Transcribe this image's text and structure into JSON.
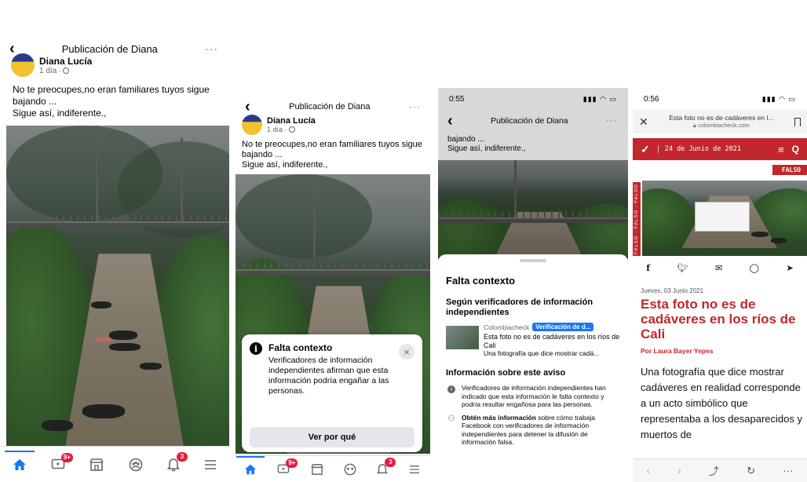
{
  "post": {
    "header_title": "Publicación de Diana",
    "author": "Diana Lucía",
    "time": "1 día ·",
    "text_line1": "No te preocupes,no eran familiares tuyos sigue bajando ...",
    "text_line2": "Sigue así, indiferente.,",
    "text_line2_p3": "bajando ...",
    "back_glyph": "‹",
    "more_glyph": "···"
  },
  "tabbar": {
    "video_badge": "9+",
    "notifications_badge": "3",
    "icons": [
      "home-icon",
      "video-icon",
      "marketplace-icon",
      "groups-icon",
      "notifications-icon",
      "menu-icon"
    ],
    "accent": "#1877f2",
    "badge_color": "#e41e3f"
  },
  "notice": {
    "title": "Falta contexto",
    "body": "Verificadores de información independientes afirman que esta información podría engañar a las personas.",
    "button": "Ver por qué"
  },
  "status": {
    "time_p3": "0:55",
    "time_p4": "0:56"
  },
  "sheet": {
    "title": "Falta contexto",
    "subtitle": "Según verificadores de información independientes",
    "source": "Colombiacheck",
    "verif_label": "Verificación de d...",
    "article_title": "Esta foto no es de cadáveres en los ríos de Cali",
    "article_desc": "Una fotografía que dice mostrar cadá...",
    "section_title": "Información sobre este aviso",
    "item1": "Verificadores de información independientes han indicado que esta información le falta contexto y podría resultar engañosa para las personas.",
    "item2_bold": "Obtén más información",
    "item2_rest": " sobre cómo trabaja Facebook con verificadores de información independientes para detener la difusión de información falsa."
  },
  "article": {
    "url_title": "Esta foto no es de cadáveres en l...",
    "url_domain": "colombiacheck.com",
    "nav_date": "24 de Junio de 2021",
    "falso_tag": "FALSO",
    "strip_text": "FALSO · FALSO · FALSO",
    "pub_date": "Jueves, 03 Junio 2021",
    "headline": "Esta foto no es de cadáveres en los ríos de Cali",
    "byline": "Por Laura Bayer Yepes",
    "body": "Una fotografía que dice mostrar cadáveres en realidad corresponde a un acto simbólico que representaba a los desaparecidos y muertos de",
    "brand_color": "#c1272d",
    "share_icons": [
      "facebook-icon",
      "twitter-icon",
      "email-icon",
      "whatsapp-icon",
      "telegram-icon"
    ]
  }
}
